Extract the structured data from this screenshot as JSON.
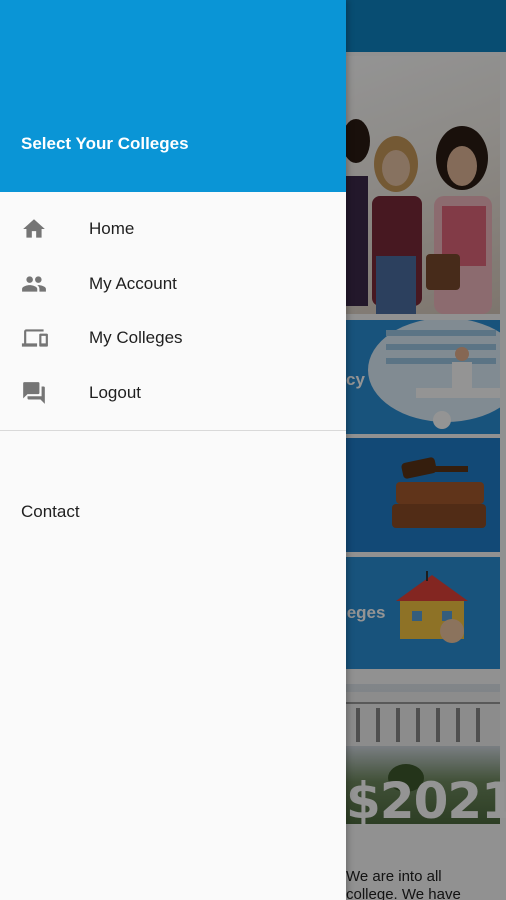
{
  "drawer": {
    "header_title": "Select Your Colleges",
    "accent_color": "#0a95d6",
    "menu": [
      {
        "label": "Home",
        "icon": "home-icon"
      },
      {
        "label": "My Account",
        "icon": "people-icon"
      },
      {
        "label": "My Colleges",
        "icon": "devices-icon"
      },
      {
        "label": "Logout",
        "icon": "chat-icon"
      }
    ],
    "contact_label": "Contact"
  },
  "background": {
    "card_pharmacy_partial": "cy",
    "card_colleges_partial": "leges",
    "year": "$2021",
    "text_line1": "We are into all",
    "text_line2": "college. We have"
  }
}
